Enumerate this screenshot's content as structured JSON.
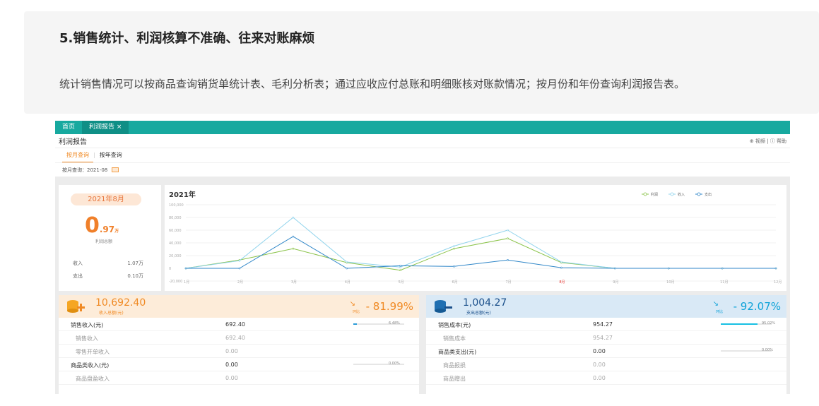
{
  "banner": {
    "title": "5.销售统计、利润核算不准确、往来对账麻烦",
    "desc": "统计销售情况可以按商品查询销货单统计表、毛利分析表；通过应收应付总账和明细账核对账款情况；按月份和年份查询利润报告表。"
  },
  "app": {
    "tabs": [
      "首页",
      "利润报告 ×"
    ],
    "page_title": "利润报告",
    "header_right": "⊕ 视频 | ⓘ 帮助",
    "subtabs": [
      "按月查询",
      "按年查询"
    ],
    "query_label": "按月查询：2021-08"
  },
  "summary": {
    "month": "2021年8月",
    "profit_int": "0",
    "profit_dec": ".97",
    "profit_unit": "万",
    "profit_label": "利润总额",
    "income_label": "收入",
    "income_value": "1.07万",
    "expense_label": "支出",
    "expense_value": "0.10万"
  },
  "chart_data": {
    "type": "line",
    "title": "2021年",
    "categories": [
      "1月",
      "2月",
      "3月",
      "4月",
      "5月",
      "6月",
      "7月",
      "8月",
      "9月",
      "10月",
      "11月",
      "12月"
    ],
    "highlight_category": "8月",
    "ylim": [
      -20000,
      100000
    ],
    "yticks": [
      -20000,
      0,
      20000,
      40000,
      60000,
      80000,
      100000
    ],
    "ytick_labels": [
      "-20,000",
      "0",
      "20,000",
      "40,000",
      "60,000",
      "80,000",
      "100,000"
    ],
    "series": [
      {
        "name": "利润",
        "color": "#8bc34a",
        "values": [
          0,
          13000,
          31000,
          9000,
          -3000,
          31000,
          47000,
          9000,
          0,
          0,
          0,
          0
        ]
      },
      {
        "name": "收入",
        "color": "#8fd3ec",
        "values": [
          0,
          12000,
          80000,
          10000,
          2000,
          35000,
          60000,
          10000,
          0,
          0,
          0,
          0
        ]
      },
      {
        "name": "支出",
        "color": "#2f86c8",
        "values": [
          0,
          0,
          50000,
          0,
          4000,
          3000,
          13000,
          1000,
          0,
          0,
          0,
          0
        ]
      }
    ],
    "legend_position": "top-right"
  },
  "income": {
    "total": "10,692.40",
    "total_label": "收入总额(元)",
    "change": "- 81.99%",
    "change_label": "环比",
    "rows": [
      {
        "name": "销售收入(元)",
        "value": "692.40",
        "bar": 0.0848,
        "pct": "6.48%",
        "sub": false
      },
      {
        "name": "销售收入",
        "value": "692.40",
        "sub": true
      },
      {
        "name": "零售开单收入",
        "value": "0.00",
        "sub": true
      },
      {
        "name": "商品类收入(元)",
        "value": "0.00",
        "bar": 0.0,
        "pct": "0.00%",
        "sub": false
      },
      {
        "name": "商品盘盈收入",
        "value": "0.00",
        "sub": true
      }
    ]
  },
  "expense": {
    "total": "1,004.27",
    "total_label": "支出总额(元)",
    "change": "- 92.07%",
    "change_label": "环比",
    "rows": [
      {
        "name": "销售成本(元)",
        "value": "954.27",
        "bar": 0.9502,
        "pct": "95.02%",
        "sub": false
      },
      {
        "name": "销售成本",
        "value": "954.27",
        "sub": true
      },
      {
        "name": "商品类支出(元)",
        "value": "0.00",
        "bar": 0.0,
        "pct": "0.00%",
        "sub": false
      },
      {
        "name": "商品报损",
        "value": "0.00",
        "sub": true
      },
      {
        "name": "商品赠出",
        "value": "0.00",
        "sub": true
      }
    ]
  }
}
